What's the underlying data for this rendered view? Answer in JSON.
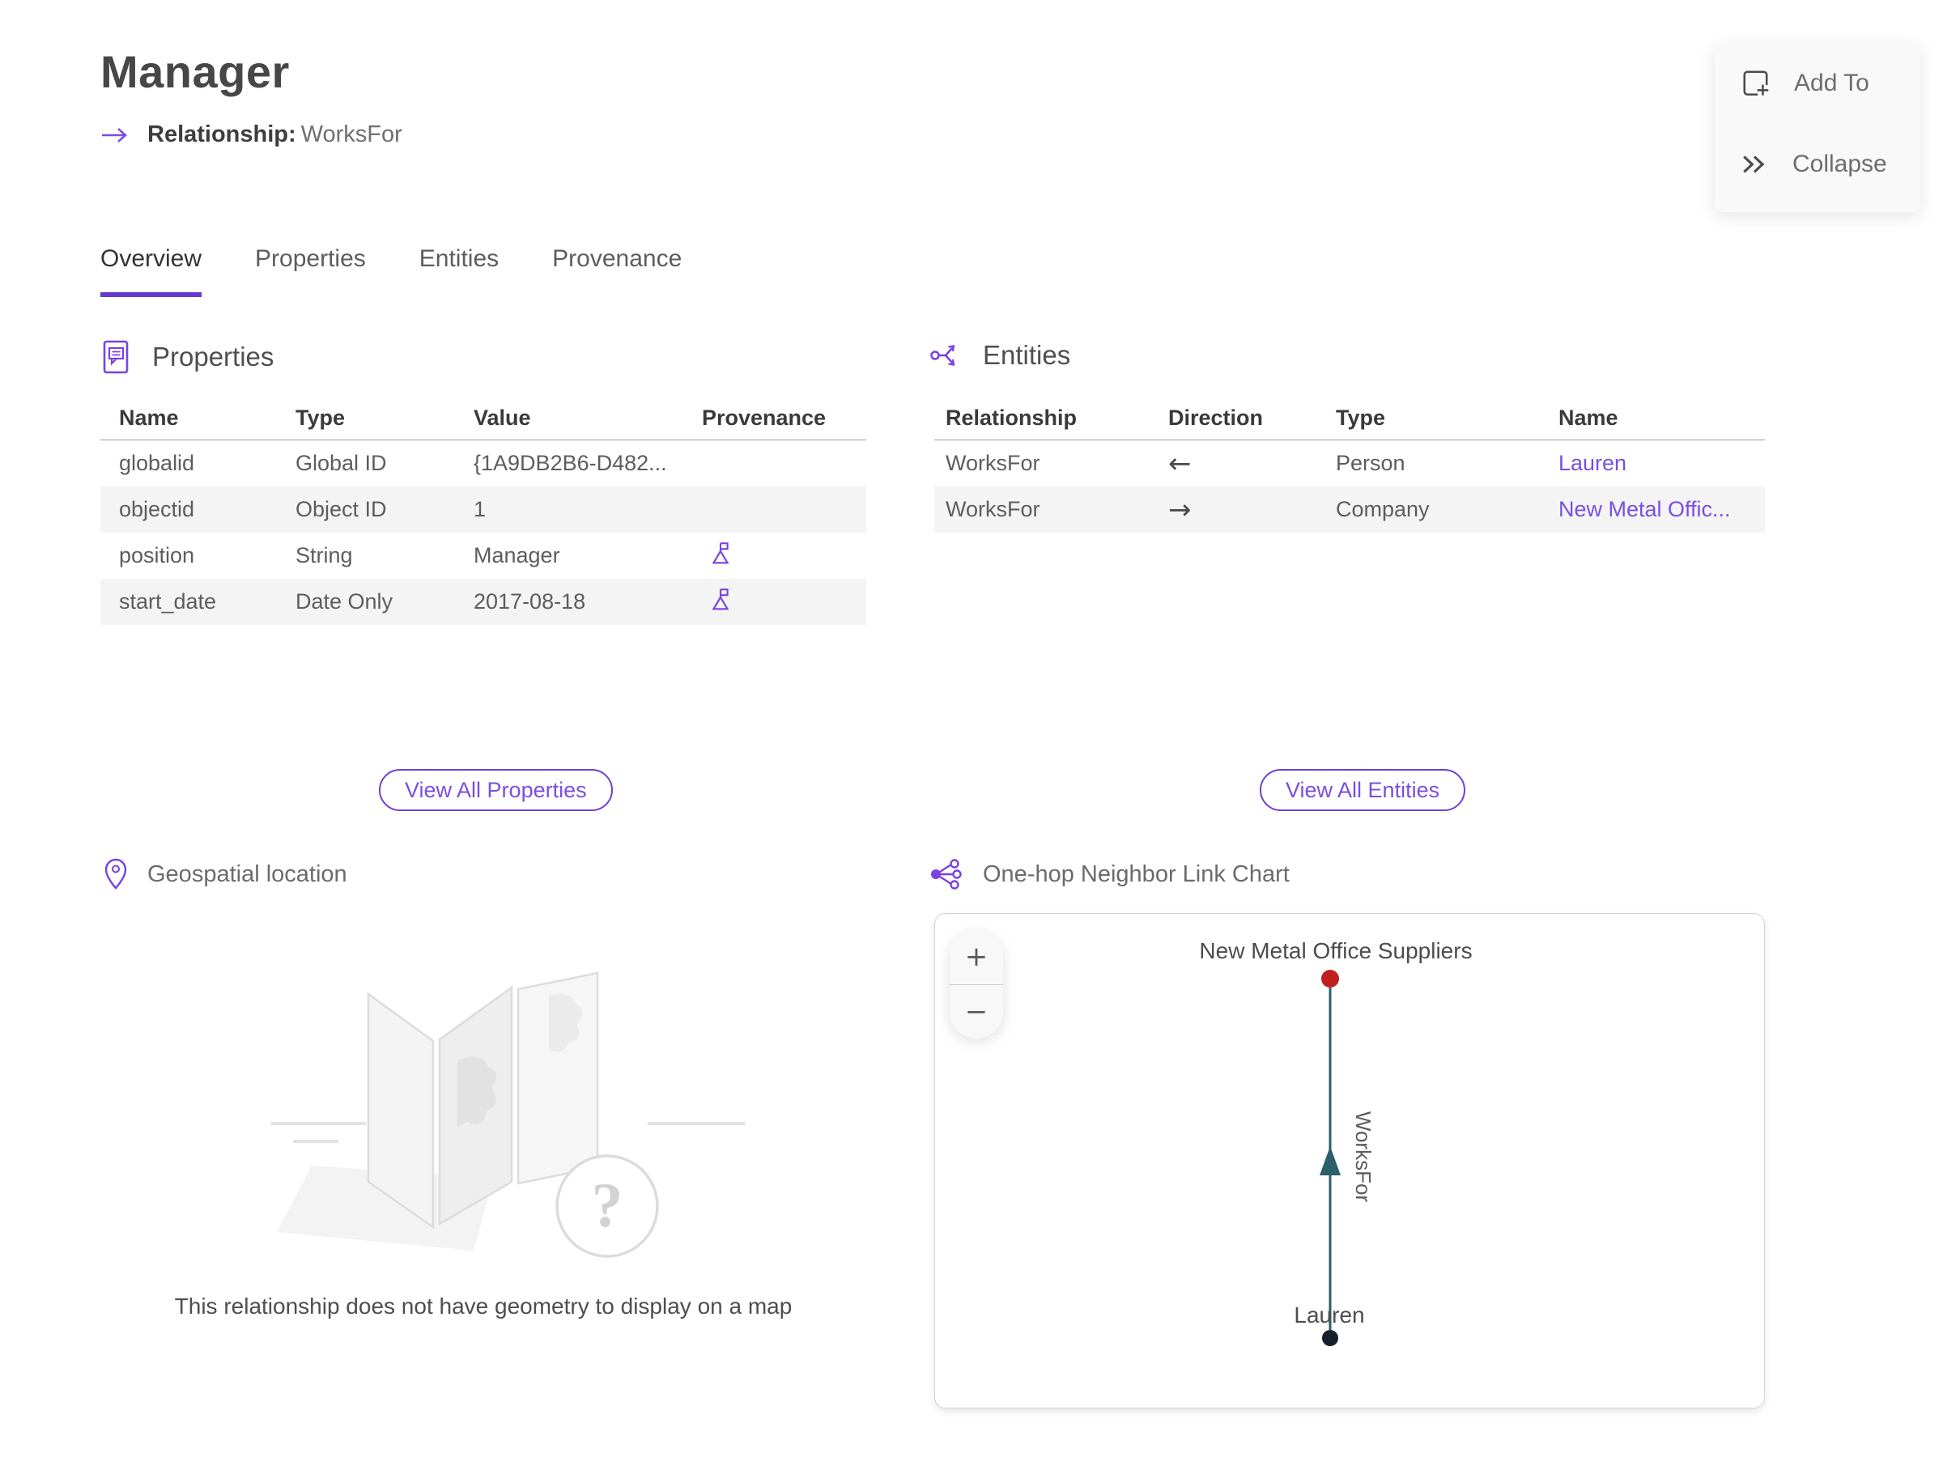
{
  "accent": {
    "purple": "#7a4fe0",
    "edge_teal": "#2a5f6b",
    "node_red": "#c01f1f",
    "node_dark": "#15212d"
  },
  "header": {
    "title": "Manager",
    "relationship_label": "Relationship:",
    "relationship_value": "WorksFor"
  },
  "actions": {
    "add_to": "Add To",
    "collapse": "Collapse"
  },
  "tabs": [
    {
      "label": "Overview"
    },
    {
      "label": "Properties"
    },
    {
      "label": "Entities"
    },
    {
      "label": "Provenance"
    }
  ],
  "properties": {
    "title": "Properties",
    "columns": [
      "Name",
      "Type",
      "Value",
      "Provenance"
    ],
    "rows": [
      {
        "name": "globalid",
        "type": "Global ID",
        "value": "{1A9DB2B6-D482..."
      },
      {
        "name": "objectid",
        "type": "Object ID",
        "value": "1"
      },
      {
        "name": "position",
        "type": "String",
        "value": "Manager"
      },
      {
        "name": "start_date",
        "type": "Date Only",
        "value": "2017-08-18"
      }
    ],
    "view_all": "View All Properties"
  },
  "entities": {
    "title": "Entities",
    "columns": [
      "Relationship",
      "Direction",
      "Type",
      "Name"
    ],
    "rows": [
      {
        "relationship": "WorksFor",
        "direction": "←",
        "type": "Person",
        "name": "Lauren"
      },
      {
        "relationship": "WorksFor",
        "direction": "→",
        "type": "Company",
        "name": "New Metal Offic..."
      }
    ],
    "view_all": "View All Entities"
  },
  "geospatial": {
    "title": "Geospatial location",
    "empty_message": "This relationship does not have geometry to display on a map",
    "placeholder_glyph": "?"
  },
  "link_chart": {
    "title": "One-hop Neighbor Link Chart",
    "zoom_in": "+",
    "zoom_out": "−",
    "graph": {
      "top_node": {
        "label": "New Metal Office Suppliers",
        "color": "#c01f1f"
      },
      "bottom_node": {
        "label": "Lauren",
        "color": "#15212d"
      },
      "edge": {
        "label": "WorksFor",
        "color": "#2a5f6b"
      }
    }
  }
}
